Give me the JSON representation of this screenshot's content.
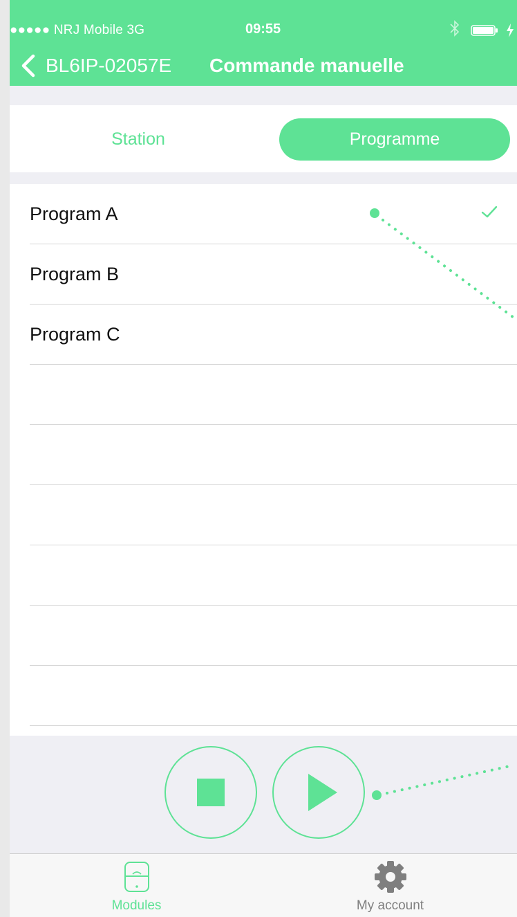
{
  "status_bar": {
    "carrier": "●●●●● NRJ Mobile  3G",
    "time": "09:55"
  },
  "nav": {
    "back_label": "BL6IP-02057E",
    "title": "Commande manuelle"
  },
  "segments": {
    "items": [
      "Station",
      "Programme"
    ],
    "selected": "Programme"
  },
  "programs": {
    "items": [
      "Program A",
      "Program B",
      "Program C"
    ],
    "selected": "Program A"
  },
  "controls": {
    "stop_icon": "stop-icon",
    "play_icon": "play-icon"
  },
  "tabbar": {
    "tabs": [
      {
        "label": "Modules",
        "icon": "modules-icon",
        "active": true
      },
      {
        "label": "My account",
        "icon": "gear-icon",
        "active": false
      }
    ]
  },
  "colors": {
    "accent": "#5ee295",
    "inactive_tab": "#7f7f7f"
  }
}
